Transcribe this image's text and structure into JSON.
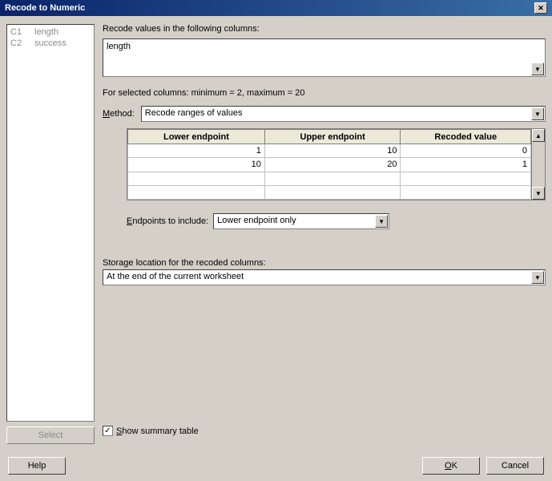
{
  "title": "Recode to Numeric",
  "columns_list": [
    {
      "id": "C1",
      "name": "length"
    },
    {
      "id": "C2",
      "name": "success"
    }
  ],
  "labels": {
    "recode_values": "Recode values in the following columns:",
    "for_selected": "For selected columns: minimum = 2, maximum = 20",
    "method": "Method:",
    "endpoints_include": "Endpoints to include:",
    "storage_location": "Storage location for the recoded columns:",
    "show_summary": "Show summary table"
  },
  "columns_selected": "length",
  "method_value": "Recode ranges of values",
  "headers": {
    "lower": "Lower endpoint",
    "upper": "Upper endpoint",
    "recoded": "Recoded value"
  },
  "rows": [
    {
      "lower": "1",
      "upper": "10",
      "recoded": "0"
    },
    {
      "lower": "10",
      "upper": "20",
      "recoded": "1"
    },
    {
      "lower": "",
      "upper": "",
      "recoded": ""
    },
    {
      "lower": "",
      "upper": "",
      "recoded": ""
    }
  ],
  "endpoints_value": "Lower endpoint only",
  "storage_value": "At the end of the current worksheet",
  "show_summary_checked": "✓",
  "buttons": {
    "select": "Select",
    "help": "Help",
    "ok": "OK",
    "cancel": "Cancel"
  }
}
